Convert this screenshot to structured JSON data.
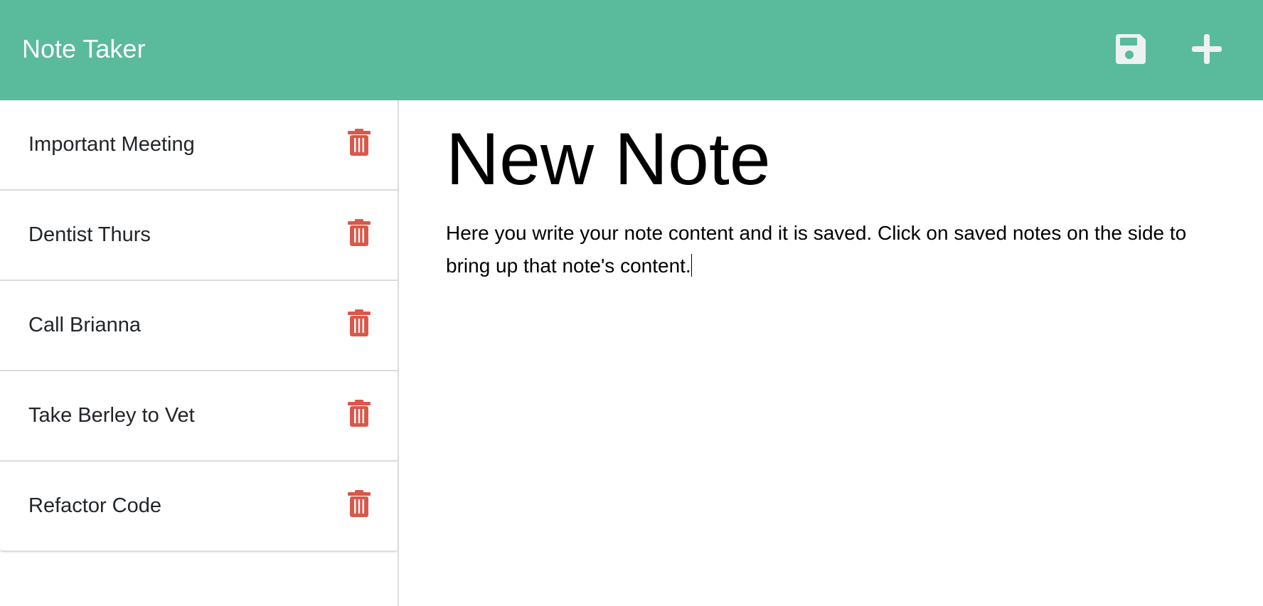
{
  "header": {
    "title": "Note Taker",
    "save_icon": "save-icon",
    "new_icon": "plus-icon"
  },
  "colors": {
    "header": "#5aba9c",
    "icon": "#eef1f2",
    "trash": "#d9584a"
  },
  "notes": [
    {
      "title": "Important Meeting"
    },
    {
      "title": "Dentist Thurs"
    },
    {
      "title": "Call Brianna"
    },
    {
      "title": "Take Berley to Vet"
    },
    {
      "title": "Refactor Code"
    }
  ],
  "editor": {
    "title": "New Note",
    "body": "Here you write your note content and it is saved. Click on saved notes on the side to bring up that note's content."
  }
}
